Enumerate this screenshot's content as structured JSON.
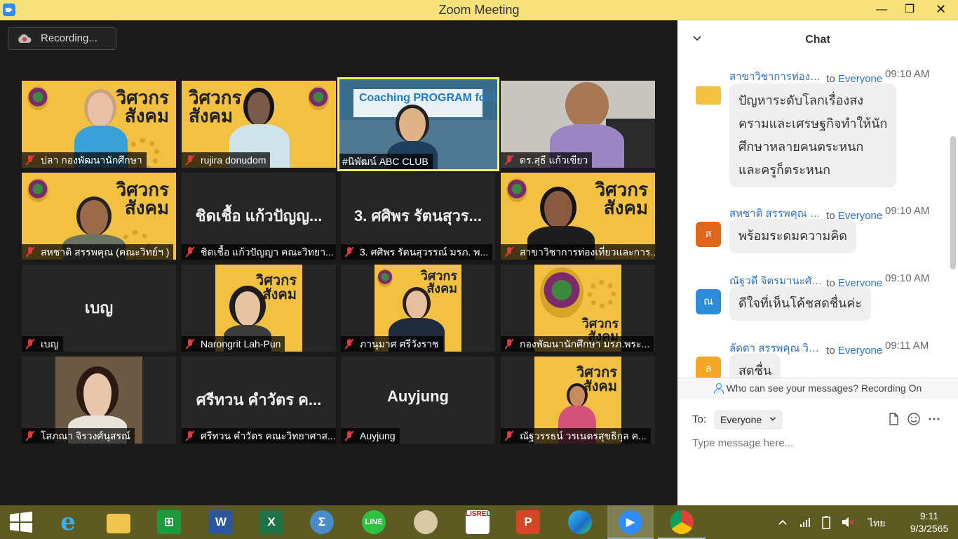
{
  "window": {
    "title": "Zoom Meeting",
    "minimize_glyph": "—",
    "maximize_glyph": "❐",
    "close_glyph": "✕"
  },
  "recording": {
    "label": "Recording..."
  },
  "tiles": [
    {
      "name": "ปลา  กองพัฒนานักศึกษา",
      "big_text": "วิศวกร\nสังคม"
    },
    {
      "name": "rujira donudom",
      "big_text": "วิศวกร\nสังคม"
    },
    {
      "name": "#นิพัฒน์ ABC CLUB",
      "slide_text": "Coaching PROGRAM for Lecturer"
    },
    {
      "name": "ดร.สุธี  แก้วเขียว"
    },
    {
      "name": "สหชาติ สรรพคุณ (คณะวิทย์ฯ )",
      "big_text": "วิศวกร\nสังคม"
    },
    {
      "name": "ชิดเชื้อ  แก้วปัญญา คณะวิทยา...",
      "display_name": "ชิดเชื้อ  แก้วปัญญ..."
    },
    {
      "name": "3. ศศิพร รัตนสุวรรณ์ มรภ. พ...",
      "display_name": "3. ศศิพร รัตนสุวร..."
    },
    {
      "name": "สาขาวิชาการท่องเที่ยวและการ...",
      "big_text": "วิศวกร\nสังคม"
    },
    {
      "name": "เบญ",
      "display_name": "เบญ"
    },
    {
      "name": "Narongrit Lah-Pun",
      "big_text": "วิศวกร\nสังคม"
    },
    {
      "name": "ภานุมาศ ศรีวังราช",
      "big_text": "วิศวกร\nสังคม"
    },
    {
      "name": "กองพัฒนานักศึกษา มรภ.พระ...",
      "big_text": "วิศวกร\nสังคม"
    },
    {
      "name": "โสภณา จิรวงศ์นุสรณ์"
    },
    {
      "name": "ศรีทวน  คำวัตร คณะวิทยาศาส...",
      "display_name": "ศรีทวน  คำวัตร ค..."
    },
    {
      "name": "Auyjung",
      "display_name": "Auyjung"
    },
    {
      "name": "ณัฐวรรธน์ วรเนตรสุขธิกุล ค...",
      "big_text": "วิศวกร\nสังคม"
    }
  ],
  "chat": {
    "title": "Chat",
    "messages": [
      {
        "sender": "สาขาวิชาการท่องเที่ย...",
        "to_word": "to",
        "recipient": "Everyone",
        "time": "09:10 AM",
        "avatar_letter": "",
        "avatar_color": "#f2c141",
        "text_lines": [
          "ปัญหาระดับโลกเรื่องสง",
          "ครามและเศรษฐกิจทำให้นัก",
          "ศึกษาหลายคนตระหนก",
          "และครูก็ตระหนก"
        ]
      },
      {
        "sender": "สหชาติ สรรพคุณ (ค...",
        "to_word": "to",
        "recipient": "Everyone",
        "time": "09:10 AM",
        "avatar_letter": "ส",
        "avatar_color": "#e0661b",
        "text_lines": [
          "พร้อมระดมความคิด"
        ]
      },
      {
        "sender": "ณัฐวดี จิตรมานะศักดิ์",
        "to_word": "to",
        "recipient": "Everyone",
        "time": "09:10 AM",
        "avatar_letter": "ณ",
        "avatar_color": "#2e8bd8",
        "text_lines": [
          "ดีใจที่เห็นโค้ชสดชื่นค่ะ"
        ]
      },
      {
        "sender": "ลัดดา สรรพคุณ วิทย...",
        "to_word": "to",
        "recipient": "Everyone",
        "time": "09:11 AM",
        "avatar_letter": "ล",
        "avatar_color": "#f2a623",
        "text_lines": [
          "สดชื่น"
        ]
      }
    ],
    "notice": "Who can see your messages? Recording On",
    "to_label": "To:",
    "to_value": "Everyone",
    "compose_placeholder": "Type message here..."
  },
  "taskbar": {
    "language": "ไทย",
    "time": "9:11",
    "date": "9/3/2565",
    "apps": [
      "start",
      "internet-explorer",
      "file-explorer",
      "store",
      "word",
      "excel",
      "math-input",
      "line",
      "paint",
      "lisrel",
      "powerpoint",
      "edge",
      "zoom",
      "chrome"
    ]
  }
}
